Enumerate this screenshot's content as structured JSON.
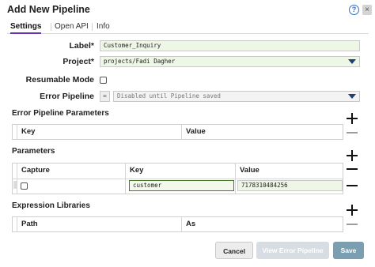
{
  "dialog": {
    "title": "Add New Pipeline"
  },
  "tabs": [
    {
      "label": "Settings"
    },
    {
      "label": "Open API"
    },
    {
      "label": "Info"
    }
  ],
  "form": {
    "label_label": "Label*",
    "label_value": "Customer_Inquiry",
    "project_label": "Project*",
    "project_value": "projects/Fadi Dagher",
    "resumable_label": "Resumable Mode",
    "resumable_checked": false,
    "error_pipeline_label": "Error Pipeline",
    "error_pipeline_eq": "=",
    "error_pipeline_value": "Disabled until Pipeline saved"
  },
  "error_params": {
    "title": "Error Pipeline Parameters",
    "columns": [
      "Key",
      "Value"
    ]
  },
  "params": {
    "title": "Parameters",
    "columns": [
      "Capture",
      "Key",
      "Value"
    ],
    "rows": [
      {
        "capture": false,
        "key": "customer",
        "value": "7178310484256"
      }
    ]
  },
  "expr_libs": {
    "title": "Expression Libraries",
    "columns": [
      "Path",
      "As"
    ]
  },
  "footer": {
    "cancel": "Cancel",
    "view_error": "View Error Pipeline",
    "save": "Save"
  },
  "colors": {
    "tab_underline": "#6a2fb5",
    "field_green": "#eef6e6",
    "save_button": "#7b9fb0",
    "help_icon": "#2a6fdb"
  },
  "icons": [
    "help-icon",
    "close-icon",
    "chevron-down-icon",
    "plus-icon",
    "minus-icon",
    "drag-handle-icon"
  ]
}
